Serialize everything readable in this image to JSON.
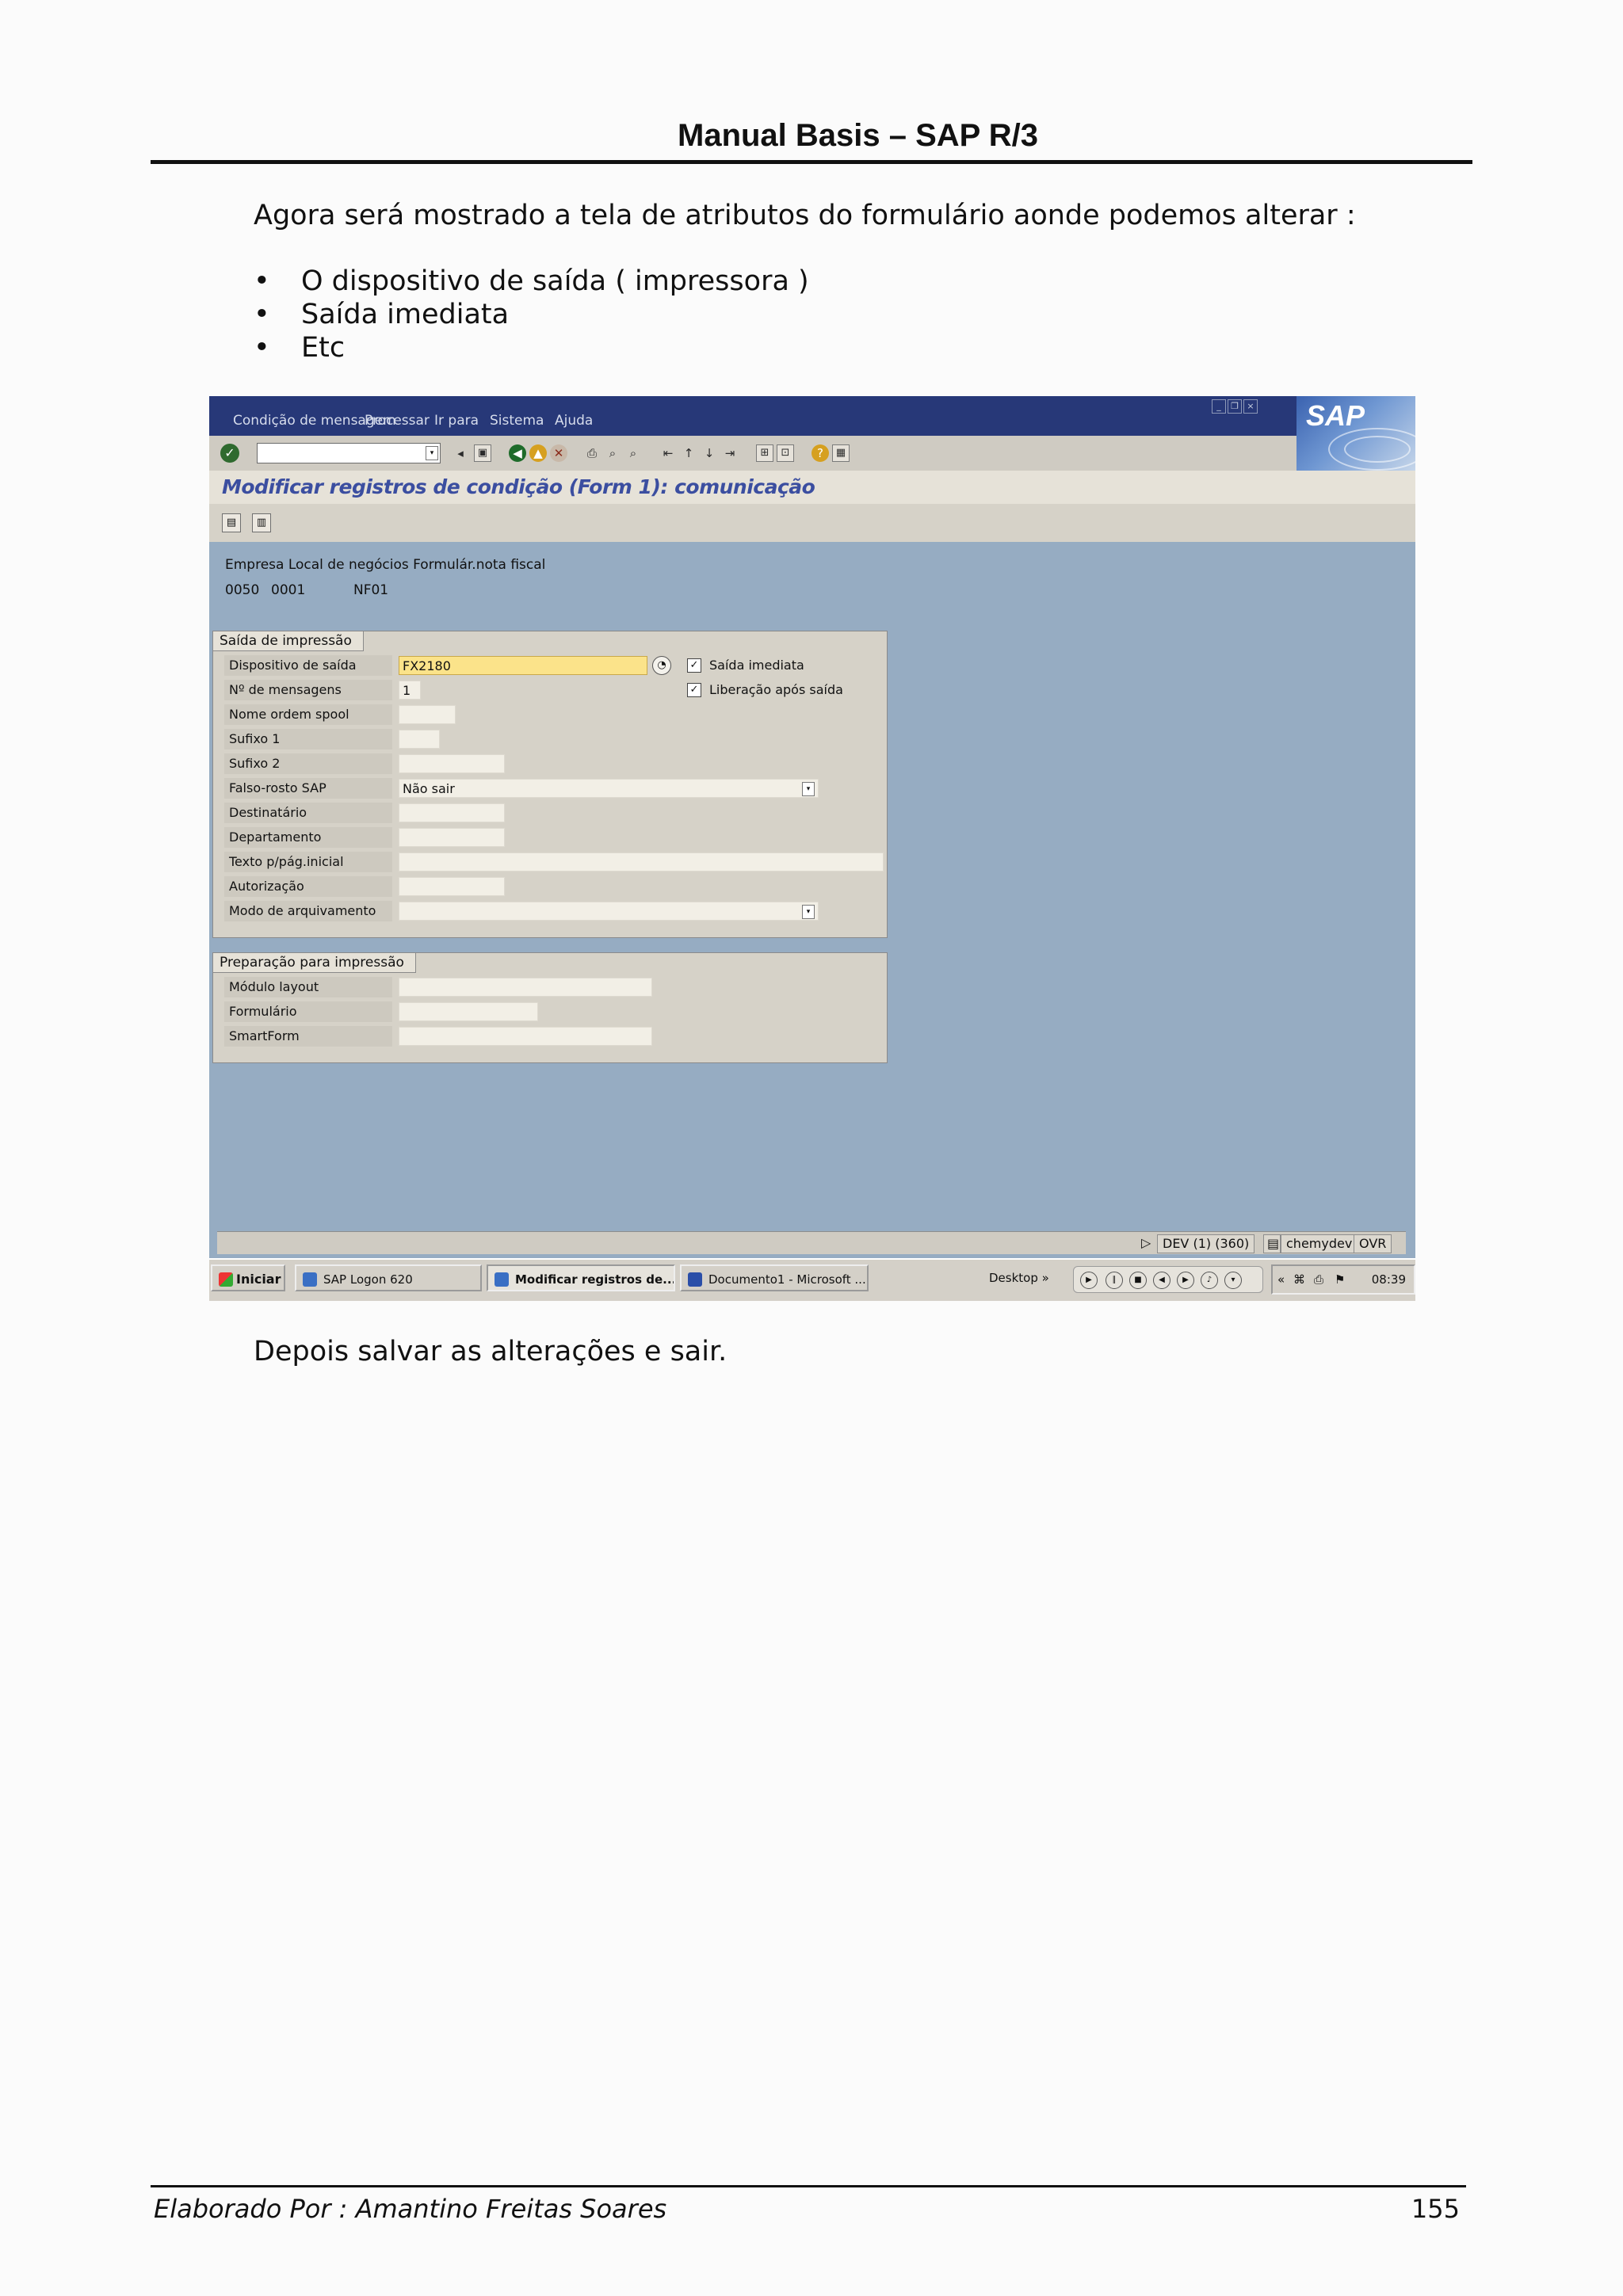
{
  "doc": {
    "header_title": "Manual Basis – SAP R/3",
    "intro": "Agora será mostrado a tela de atributos do formulário aonde podemos alterar :",
    "bullets": [
      "O dispositivo de saída ( impressora )",
      "Saída imediata",
      "Etc"
    ],
    "outro": "Depois salvar as alterações e sair.",
    "footer_author": "Elaborado Por : Amantino Freitas Soares",
    "page_number": "155"
  },
  "sap": {
    "menu": [
      "Condição de mensagem",
      "Processar",
      "Ir para",
      "Sistema",
      "Ajuda"
    ],
    "logo": "SAP",
    "screen_title": "Modificar registros de condição (Form 1): comunicação",
    "header_labels": "Empresa Local de negócios Formulár.nota fiscal",
    "header_values": [
      "0050",
      "0001",
      "NF01"
    ],
    "group1_title": "Saída de impressão",
    "group1_fields": [
      {
        "label": "Dispositivo de saída",
        "value": "FX2180"
      },
      {
        "label": "Nº de mensagens",
        "value": "1"
      },
      {
        "label": "Nome ordem spool",
        "value": ""
      },
      {
        "label": "Sufixo 1",
        "value": ""
      },
      {
        "label": "Sufixo 2",
        "value": ""
      },
      {
        "label": "Falso-rosto SAP",
        "value": "Não sair"
      },
      {
        "label": "Destinatário",
        "value": ""
      },
      {
        "label": "Departamento",
        "value": ""
      },
      {
        "label": "Texto p/pág.inicial",
        "value": ""
      },
      {
        "label": "Autorização",
        "value": ""
      },
      {
        "label": "Modo de arquivamento",
        "value": ""
      }
    ],
    "checkboxes": [
      {
        "label": "Saída imediata",
        "checked": true
      },
      {
        "label": "Liberação após saída",
        "checked": true
      }
    ],
    "group2_title": "Preparação para impressão",
    "group2_fields": [
      {
        "label": "Módulo layout",
        "value": ""
      },
      {
        "label": "Formulário",
        "value": ""
      },
      {
        "label": "SmartForm",
        "value": ""
      }
    ],
    "status": {
      "system": "DEV (1) (360)",
      "host": "chemydev",
      "mode": "OVR"
    },
    "taskbar": {
      "start": "Iniciar",
      "tasks": [
        "SAP Logon 620",
        "Modificar registros de...",
        "Documento1 - Microsoft ..."
      ],
      "desktop": "Desktop",
      "clock": "08:39"
    },
    "colors": {
      "menubar": "#273878",
      "background": "#96acc2",
      "title": "#3b4ea0",
      "active_field": "#fbe38a"
    }
  }
}
